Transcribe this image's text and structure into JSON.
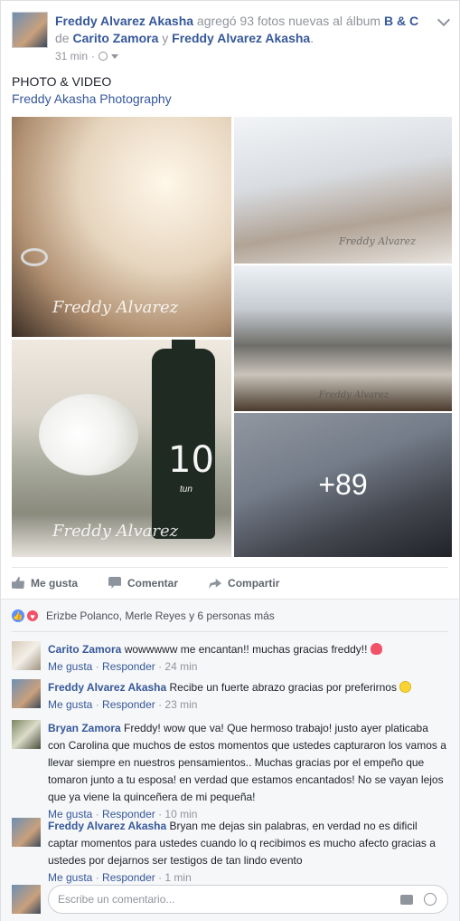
{
  "post": {
    "author": "Freddy Alvarez Akasha",
    "action": "agregó 93 fotos nuevas al álbum",
    "album": "B & C",
    "de": "de",
    "tag1": "Carito Zamora",
    "y": "y",
    "tag2": "Freddy Alvarez Akasha",
    "period": ".",
    "time": "31 min",
    "sep": "·",
    "title": "PHOTO & VIDEO",
    "subtitle": "Freddy Akasha Photography"
  },
  "photos": {
    "watermark": "Freddy Alvarez",
    "bottle_number": "10",
    "bottle_sub": "tun",
    "more_count": "+89"
  },
  "actions": {
    "like": "Me gusta",
    "comment": "Comentar",
    "share": "Compartir"
  },
  "reactions": {
    "text": "Erizbe Polanco, Merle Reyes y 6 personas más"
  },
  "comments": [
    {
      "name": "Carito Zamora",
      "text": "wowwwww me encantan!! muchas gracias freddy!!",
      "like": "Me gusta",
      "reply": "Responder",
      "time": "24 min"
    },
    {
      "name": "Freddy Alvarez Akasha",
      "text": "Recibe un fuerte abrazo gracias por preferirnos",
      "like": "Me gusta",
      "reply": "Responder",
      "time": "23 min"
    },
    {
      "name": "Bryan Zamora",
      "text": "Freddy! wow que va! Que hermoso trabajo! justo ayer platicaba con Carolina que muchos de estos momentos que ustedes capturaron los vamos a llevar siempre en nuestros pensamientos.. Muchas gracias por el empeño que tomaron junto a tu esposa! en verdad que estamos encantados! No se vayan lejos que ya viene la quinceñera de mi pequeña!",
      "like": "Me gusta",
      "reply": "Responder",
      "time": "10 min"
    },
    {
      "name": "Freddy Alvarez Akasha",
      "text": "Bryan me dejas sin palabras, en verdad no es dificil captar momentos para ustedes cuando lo q recibimos es mucho afecto gracias a ustedes por dejarnos ser testigos de tan lindo evento",
      "like": "Me gusta",
      "reply": "Responder",
      "time": "1 min"
    }
  ],
  "compose": {
    "placeholder": "Escribe un comentario..."
  }
}
